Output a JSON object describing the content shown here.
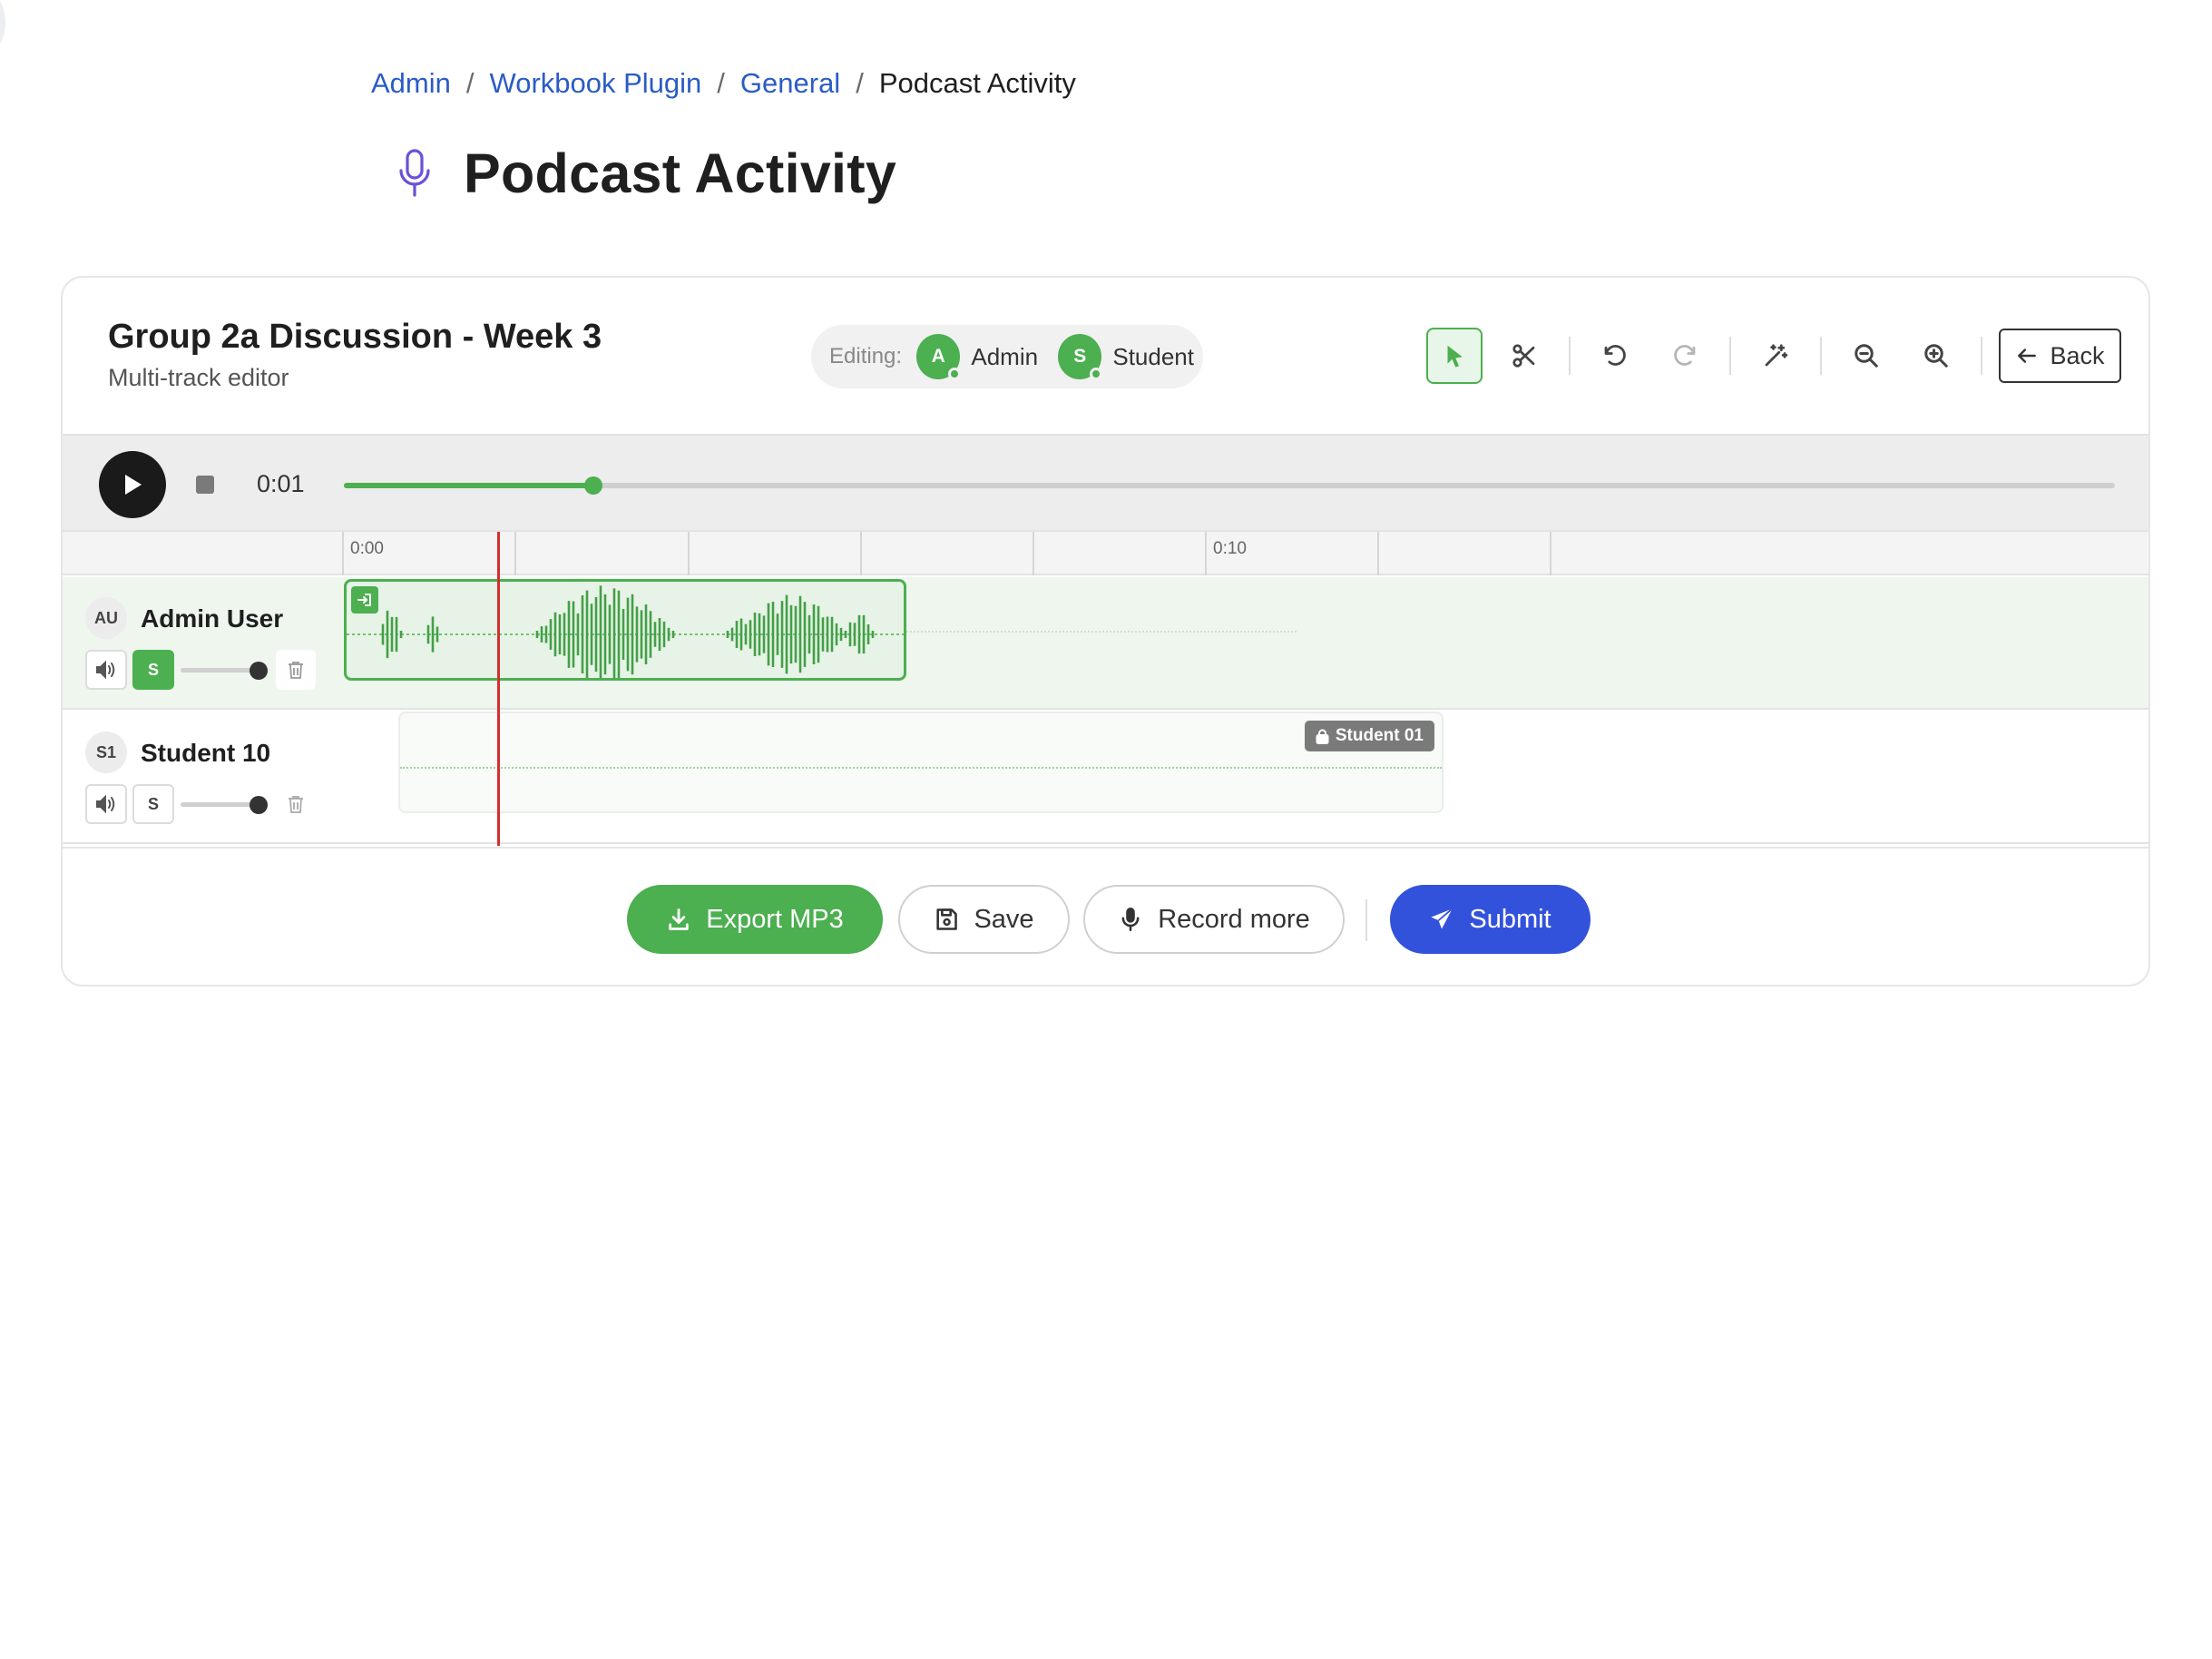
{
  "breadcrumb": {
    "items": [
      "Admin",
      "Workbook Plugin",
      "General"
    ],
    "current": "Podcast Activity",
    "separator": "/"
  },
  "page": {
    "title": "Podcast Activity",
    "icon": "microphone-icon",
    "accent_color": "#6c4fd8"
  },
  "project": {
    "title": "Group 2a Discussion - Week 3",
    "subtitle": "Multi-track editor"
  },
  "editing": {
    "label": "Editing:",
    "editors": [
      {
        "initial": "A",
        "name": "Admin"
      },
      {
        "initial": "S",
        "name": "Student"
      }
    ]
  },
  "toolbar": {
    "tools": [
      "select-cursor-icon",
      "scissors-icon",
      "undo-icon",
      "redo-icon",
      "magic-wand-icon",
      "zoom-out-icon",
      "zoom-in-icon"
    ],
    "back_label": "Back"
  },
  "transport": {
    "time": "0:01",
    "progress": 0.141
  },
  "ruler": {
    "labels": [
      "0:00",
      "0:10"
    ]
  },
  "tracks": [
    {
      "initials": "AU",
      "name": "Admin User",
      "solo": "S",
      "solo_active": true,
      "volume": 1.0
    },
    {
      "initials": "S1",
      "name": "Student 10",
      "solo": "S",
      "solo_active": false,
      "volume": 1.0,
      "clip_badge": "Student 01",
      "locked": true
    }
  ],
  "footer": {
    "export_label": "Export MP3",
    "save_label": "Save",
    "record_label": "Record more",
    "submit_label": "Submit"
  },
  "colors": {
    "green": "#4caf50",
    "submit_blue": "#3352db",
    "link_blue": "#2b5cc4",
    "playhead_red": "#d32f2f"
  }
}
